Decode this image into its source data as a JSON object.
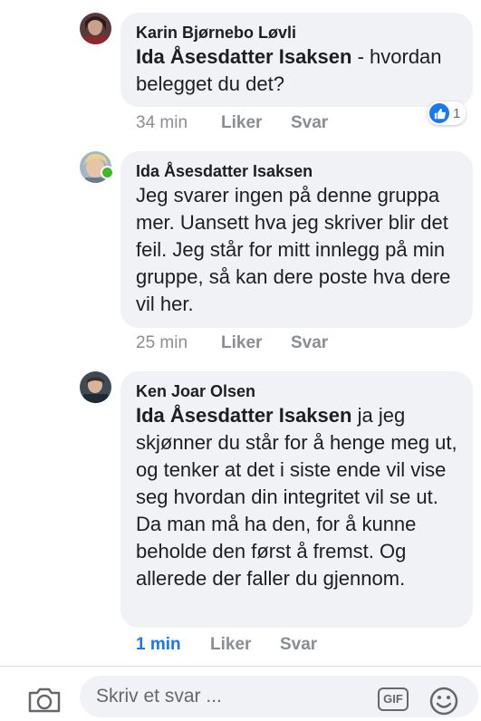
{
  "comments": [
    {
      "author": "Karin Bjørnebo Løvli",
      "mention": "Ida Åsesdatter Isaksen",
      "text": " - hvordan belegget du det?",
      "time": "34 min",
      "like_label": "Liker",
      "reply_label": "Svar",
      "reaction_count": "1"
    },
    {
      "author": "Ida Åsesdatter Isaksen",
      "text": "Jeg svarer ingen på denne gruppa mer. Uansett hva jeg skriver blir det feil. Jeg står for mitt innlegg på min gruppe, så kan dere poste hva dere vil her.",
      "time": "25 min",
      "like_label": "Liker",
      "reply_label": "Svar"
    },
    {
      "author": "Ken Joar Olsen",
      "mention": "Ida Åsesdatter Isaksen",
      "text": " ja jeg skjønner du står for å henge meg ut, og tenker at det i siste ende vil vise seg hvordan din integritet vil se ut. Da man må ha den, for å kunne beholde den først å fremst. Og allerede der faller du gjennom.",
      "time": "1 min",
      "like_label": "Liker",
      "reply_label": "Svar"
    }
  ],
  "composer": {
    "placeholder": "Skriv et svar ...",
    "gif_label": "GIF"
  },
  "colors": {
    "accent": "#1877f2",
    "bubble": "#f0f2f5",
    "meta": "#8a8d91",
    "online": "#42b72a"
  }
}
